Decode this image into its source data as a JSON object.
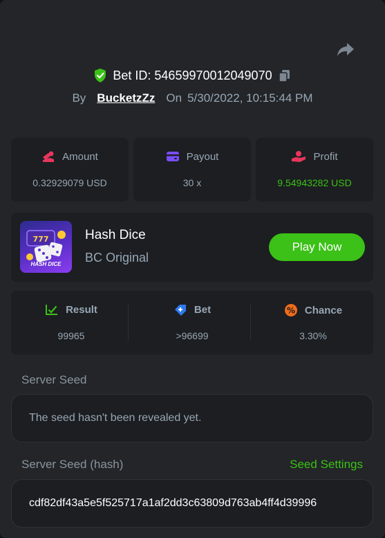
{
  "header": {
    "bet_id_label": "Bet ID: 54659970012049070",
    "by_label": "By",
    "username": "BucketzZz",
    "on_label": "On",
    "datetime": "5/30/2022, 10:15:44 PM"
  },
  "stats": [
    {
      "label": "Amount",
      "value": "0.32929079 USD"
    },
    {
      "label": "Payout",
      "value": "30 x"
    },
    {
      "label": "Profit",
      "value": "9.54943282 USD"
    }
  ],
  "game": {
    "title": "Hash Dice",
    "subtitle": "BC Original",
    "thumb_text": "HASH DICE",
    "play_label": "Play Now"
  },
  "results": [
    {
      "label": "Result",
      "value": "99965"
    },
    {
      "label": "Bet",
      "value": ">96699"
    },
    {
      "label": "Chance",
      "value": "3.30%"
    }
  ],
  "server_seed": {
    "label": "Server Seed",
    "value": "The seed hasn't been revealed yet."
  },
  "server_seed_hash": {
    "label": "Server Seed (hash)",
    "settings_label": "Seed Settings",
    "value": "cdf82df43a5e5f525717a1af2dd3c63809d763ab4ff4d39996"
  },
  "colors": {
    "accent_green": "#3bc117",
    "panel_bg": "#232528",
    "card_bg": "#1c1e21",
    "muted_text": "#98a7b5",
    "amount_icon": "#e8365e",
    "payout_icon": "#7b4dff",
    "profit_icon": "#e8365e",
    "bet_icon": "#2f7af0",
    "chance_icon": "#f06b1a"
  },
  "icons": {
    "share": "share-arrow-icon",
    "verified": "shield-check-icon",
    "copy": "copy-icon",
    "amount": "coins-icon",
    "payout": "wallet-icon",
    "profit": "hand-coin-icon",
    "result": "chart-check-icon",
    "bet": "ticket-icon",
    "chance": "percent-icon"
  }
}
